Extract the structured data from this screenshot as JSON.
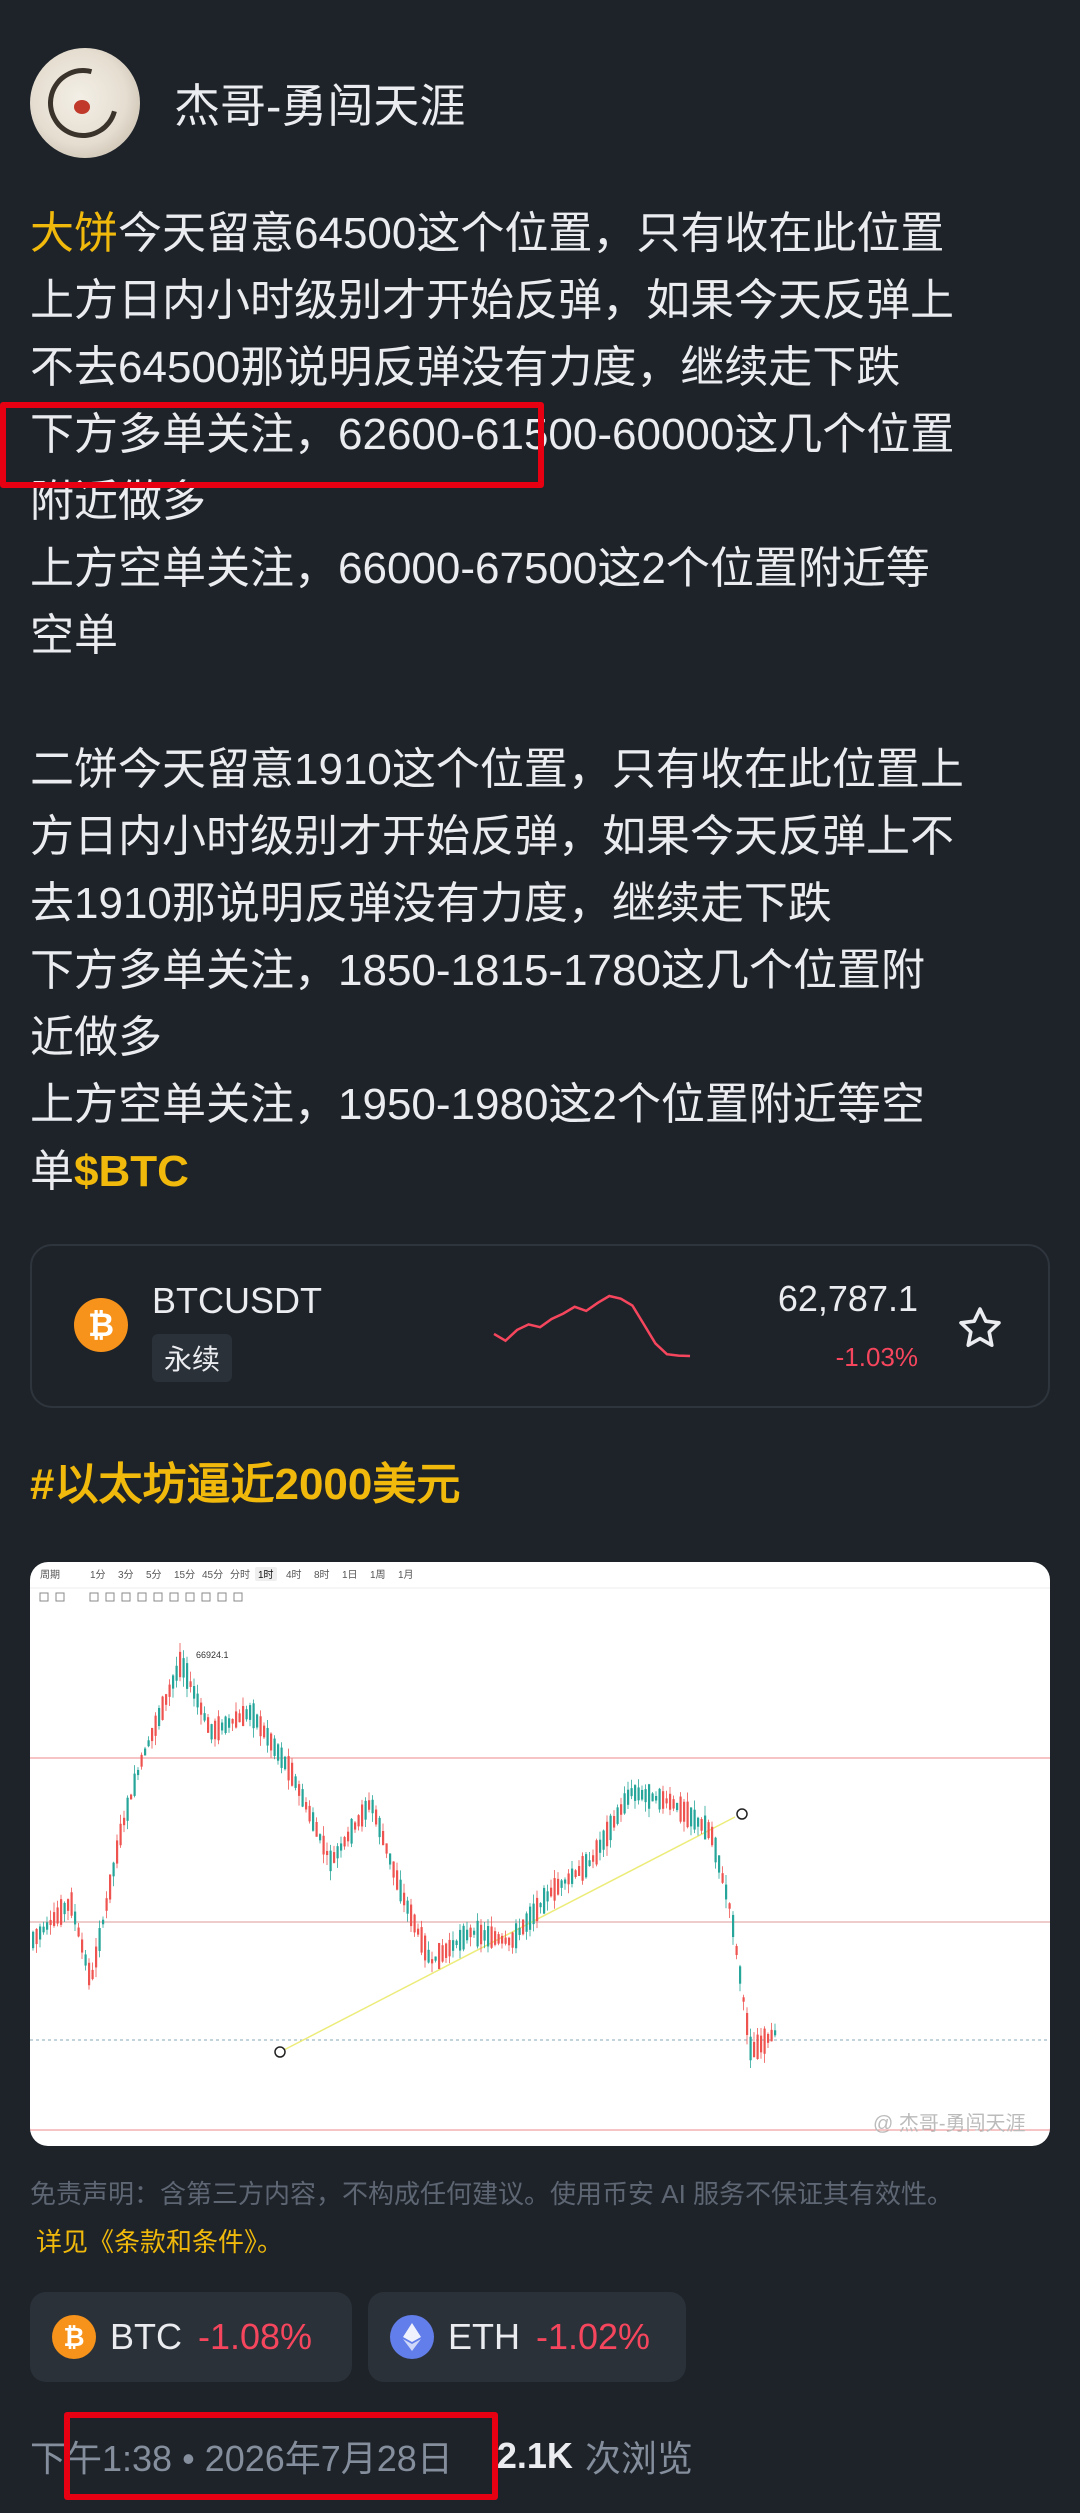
{
  "author": {
    "name": "杰哥-勇闯天涯"
  },
  "post": {
    "para1": {
      "highlight": "大饼",
      "line1": "今天留意64500这个位置，只有收在此位置",
      "line2": "上方日内小时级别才开始反弹，如果今天反弹上",
      "line3": "不去64500那说明反弹没有力度，继续走下跌",
      "line4": "下方多单关注，62600-61500-60000这几个位置",
      "line5": "附近做多",
      "line6": "上方空单关注，66000-67500这2个位置附近等",
      "line7": "空单"
    },
    "para2": {
      "line1": "二饼今天留意1910这个位置，只有收在此位置上",
      "line2": "方日内小时级别才开始反弹，如果今天反弹上不",
      "line3": "去1910那说明反弹没有力度，继续走下跌",
      "line4": "下方多单关注，1850-1815-1780这几个位置附",
      "line5": "近做多",
      "line6": "上方空单关注，1950-1980这2个位置附近等空",
      "line7": "单",
      "cashtag": "$BTC"
    }
  },
  "ticker": {
    "symbol": "BTCUSDT",
    "badge": "永续",
    "price": "62,787.1",
    "change": "-1.03%",
    "icon": "bitcoin-icon",
    "sparkline": [
      62950,
      62900,
      62980,
      63020,
      63000,
      63060,
      63100,
      63150,
      63120,
      63180,
      63230,
      63210,
      63160,
      63020,
      62880,
      62800,
      62790,
      62787
    ]
  },
  "hashtag": "#以太坊逼近2000美元",
  "chart_image": {
    "peak_label": "66924.1",
    "toolbar_timeframes": [
      "1分",
      "3分",
      "5分",
      "15分",
      "45分",
      "分时",
      "1时",
      "4时",
      "8时",
      "1日",
      "1周",
      "1月"
    ],
    "toolbar_active": "1时",
    "toolbar_first": "周期",
    "watermark": "@ 杰哥-勇闯天涯"
  },
  "disclaimer": {
    "text": "免责声明：含第三方内容，不构成任何建议。使用币安 AI 服务不保证其有效性。",
    "link": "详见《条款和条件》。"
  },
  "coins": [
    {
      "symbol": "BTC",
      "change": "-1.08%",
      "icon": "bitcoin-icon",
      "color": "#f7931a"
    },
    {
      "symbol": "ETH",
      "change": "-1.02%",
      "icon": "ethereum-icon",
      "color": "#627eea"
    }
  ],
  "footer": {
    "timestamp": "下午1:38 • 2026年7月28日",
    "views_count": "2.1K",
    "views_label": "次浏览"
  },
  "colors": {
    "accent": "#f0b90b",
    "down": "#f6465d",
    "background": "#1e2329",
    "highlight_box": "#e60012"
  }
}
